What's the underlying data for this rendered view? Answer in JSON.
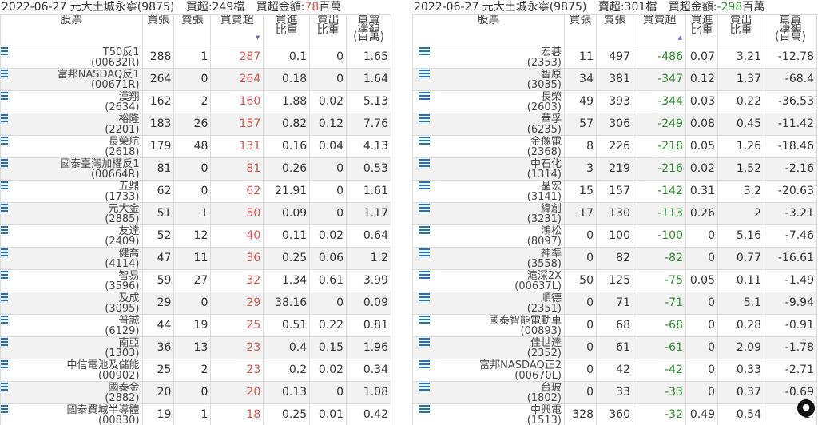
{
  "left": {
    "title": {
      "date_broker": "2022-06-27 元大土城永寧(9875)",
      "count_label": "買超:249檔",
      "amount_label": "買超金額:",
      "amount_value": "78",
      "amount_unit": "百萬"
    },
    "headers": {
      "stock": "股票",
      "buy": "買張",
      "sell": "賣張",
      "net": "買賣超",
      "buy_ratio": "買進\n比重",
      "sell_ratio": "賣出\n比重",
      "amount": "買賣\n淨額\n(百萬)"
    },
    "rows": [
      {
        "name": "T50反1",
        "code": "(00632R)",
        "buy": "288",
        "sell": "1",
        "net": "287",
        "buy_ratio": "0.1",
        "sell_ratio": "0",
        "amount": "1.65"
      },
      {
        "name": "富邦NASDAQ反1",
        "code": "(00671R)",
        "buy": "264",
        "sell": "0",
        "net": "264",
        "buy_ratio": "0.18",
        "sell_ratio": "0",
        "amount": "1.64"
      },
      {
        "name": "漢翔",
        "code": "(2634)",
        "buy": "162",
        "sell": "2",
        "net": "160",
        "buy_ratio": "1.88",
        "sell_ratio": "0.02",
        "amount": "5.13"
      },
      {
        "name": "裕隆",
        "code": "(2201)",
        "buy": "183",
        "sell": "26",
        "net": "157",
        "buy_ratio": "0.82",
        "sell_ratio": "0.12",
        "amount": "7.76"
      },
      {
        "name": "長榮航",
        "code": "(2618)",
        "buy": "179",
        "sell": "48",
        "net": "131",
        "buy_ratio": "0.16",
        "sell_ratio": "0.04",
        "amount": "4.13"
      },
      {
        "name": "國泰臺灣加權反1",
        "code": "(00664R)",
        "buy": "81",
        "sell": "0",
        "net": "81",
        "buy_ratio": "0.26",
        "sell_ratio": "0",
        "amount": "0.53"
      },
      {
        "name": "五鼎",
        "code": "(1733)",
        "buy": "62",
        "sell": "0",
        "net": "62",
        "buy_ratio": "21.91",
        "sell_ratio": "0",
        "amount": "1.61"
      },
      {
        "name": "元大金",
        "code": "(2885)",
        "buy": "51",
        "sell": "1",
        "net": "50",
        "buy_ratio": "0.09",
        "sell_ratio": "0",
        "amount": "1.17"
      },
      {
        "name": "友達",
        "code": "(2409)",
        "buy": "52",
        "sell": "12",
        "net": "40",
        "buy_ratio": "0.11",
        "sell_ratio": "0.02",
        "amount": "0.64"
      },
      {
        "name": "健喬",
        "code": "(4114)",
        "buy": "47",
        "sell": "11",
        "net": "36",
        "buy_ratio": "0.25",
        "sell_ratio": "0.06",
        "amount": "1.2"
      },
      {
        "name": "智易",
        "code": "(3596)",
        "buy": "59",
        "sell": "27",
        "net": "32",
        "buy_ratio": "1.34",
        "sell_ratio": "0.61",
        "amount": "3.99"
      },
      {
        "name": "及成",
        "code": "(3095)",
        "buy": "29",
        "sell": "0",
        "net": "29",
        "buy_ratio": "38.16",
        "sell_ratio": "0",
        "amount": "0.09"
      },
      {
        "name": "普誠",
        "code": "(6129)",
        "buy": "44",
        "sell": "19",
        "net": "25",
        "buy_ratio": "0.51",
        "sell_ratio": "0.22",
        "amount": "0.81"
      },
      {
        "name": "南亞",
        "code": "(1303)",
        "buy": "36",
        "sell": "13",
        "net": "23",
        "buy_ratio": "0.4",
        "sell_ratio": "0.15",
        "amount": "1.96"
      },
      {
        "name": "中信電池及儲能",
        "code": "(00902)",
        "buy": "25",
        "sell": "2",
        "net": "23",
        "buy_ratio": "0.2",
        "sell_ratio": "0.02",
        "amount": "0.34"
      },
      {
        "name": "國泰金",
        "code": "(2882)",
        "buy": "20",
        "sell": "0",
        "net": "20",
        "buy_ratio": "0.13",
        "sell_ratio": "0",
        "amount": "1.08"
      },
      {
        "name": "國泰費城半導體",
        "code": "(00830)",
        "buy": "19",
        "sell": "1",
        "net": "18",
        "buy_ratio": "0.25",
        "sell_ratio": "0.01",
        "amount": "0.42"
      }
    ]
  },
  "right": {
    "title": {
      "date_broker": "2022-06-27 元大土城永寧(9875)",
      "count_label": "賣超:301檔",
      "amount_label": "買超金額:",
      "amount_value": "-298",
      "amount_unit": "百萬"
    },
    "headers": {
      "stock": "股票",
      "buy": "買張",
      "sell": "賣張",
      "net": "買賣超",
      "buy_ratio": "買進\n比重",
      "sell_ratio": "賣出\n比重",
      "amount": "買賣\n淨額\n(百萬)"
    },
    "rows": [
      {
        "name": "宏碁",
        "code": "(2353)",
        "buy": "11",
        "sell": "497",
        "net": "-486",
        "buy_ratio": "0.07",
        "sell_ratio": "3.21",
        "amount": "-12.78"
      },
      {
        "name": "智原",
        "code": "(3035)",
        "buy": "34",
        "sell": "381",
        "net": "-347",
        "buy_ratio": "0.12",
        "sell_ratio": "1.37",
        "amount": "-68.4"
      },
      {
        "name": "長榮",
        "code": "(2603)",
        "buy": "49",
        "sell": "393",
        "net": "-344",
        "buy_ratio": "0.03",
        "sell_ratio": "0.22",
        "amount": "-36.53"
      },
      {
        "name": "華孚",
        "code": "(6235)",
        "buy": "57",
        "sell": "306",
        "net": "-249",
        "buy_ratio": "0.08",
        "sell_ratio": "0.45",
        "amount": "-11.42"
      },
      {
        "name": "金像電",
        "code": "(2368)",
        "buy": "8",
        "sell": "226",
        "net": "-218",
        "buy_ratio": "0.05",
        "sell_ratio": "1.26",
        "amount": "-18.46"
      },
      {
        "name": "中石化",
        "code": "(1314)",
        "buy": "3",
        "sell": "219",
        "net": "-216",
        "buy_ratio": "0.02",
        "sell_ratio": "1.52",
        "amount": "-2.16"
      },
      {
        "name": "晶宏",
        "code": "(3141)",
        "buy": "15",
        "sell": "157",
        "net": "-142",
        "buy_ratio": "0.31",
        "sell_ratio": "3.2",
        "amount": "-20.63"
      },
      {
        "name": "緯創",
        "code": "(3231)",
        "buy": "17",
        "sell": "130",
        "net": "-113",
        "buy_ratio": "0.26",
        "sell_ratio": "2",
        "amount": "-3.21"
      },
      {
        "name": "鴻松",
        "code": "(8097)",
        "buy": "0",
        "sell": "100",
        "net": "-100",
        "buy_ratio": "0",
        "sell_ratio": "5.16",
        "amount": "-7.46"
      },
      {
        "name": "神準",
        "code": "(3558)",
        "buy": "0",
        "sell": "82",
        "net": "-82",
        "buy_ratio": "0",
        "sell_ratio": "0.77",
        "amount": "-16.61"
      },
      {
        "name": "滬深2X",
        "code": "(00637L)",
        "buy": "50",
        "sell": "125",
        "net": "-75",
        "buy_ratio": "0.05",
        "sell_ratio": "0.11",
        "amount": "-1.49"
      },
      {
        "name": "順德",
        "code": "(2351)",
        "buy": "0",
        "sell": "71",
        "net": "-71",
        "buy_ratio": "0",
        "sell_ratio": "5.1",
        "amount": "-9.94"
      },
      {
        "name": "國泰智能電動車",
        "code": "(00893)",
        "buy": "0",
        "sell": "68",
        "net": "-68",
        "buy_ratio": "0",
        "sell_ratio": "0.28",
        "amount": "-0.91"
      },
      {
        "name": "佳世達",
        "code": "(2352)",
        "buy": "0",
        "sell": "61",
        "net": "-61",
        "buy_ratio": "0",
        "sell_ratio": "2.09",
        "amount": "-1.78"
      },
      {
        "name": "富邦NASDAQ正2",
        "code": "(00670L)",
        "buy": "0",
        "sell": "42",
        "net": "-42",
        "buy_ratio": "0",
        "sell_ratio": "0.33",
        "amount": "-2.71"
      },
      {
        "name": "台玻",
        "code": "(1802)",
        "buy": "0",
        "sell": "33",
        "net": "-33",
        "buy_ratio": "0",
        "sell_ratio": "0.37",
        "amount": "-0.69"
      },
      {
        "name": "中興電",
        "code": "(1513)",
        "buy": "328",
        "sell": "360",
        "net": "-32",
        "buy_ratio": "0.49",
        "sell_ratio": "0.54",
        "amount": "-1."
      }
    ]
  },
  "icons": {
    "row_detail": "list-icon",
    "sort_desc": "sort-desc-icon",
    "sort_asc": "sort-asc-icon",
    "corner": "action-button"
  },
  "colors": {
    "positive": "#e05050",
    "negative": "#2e8b2e",
    "icon": "#1f6fd1"
  }
}
